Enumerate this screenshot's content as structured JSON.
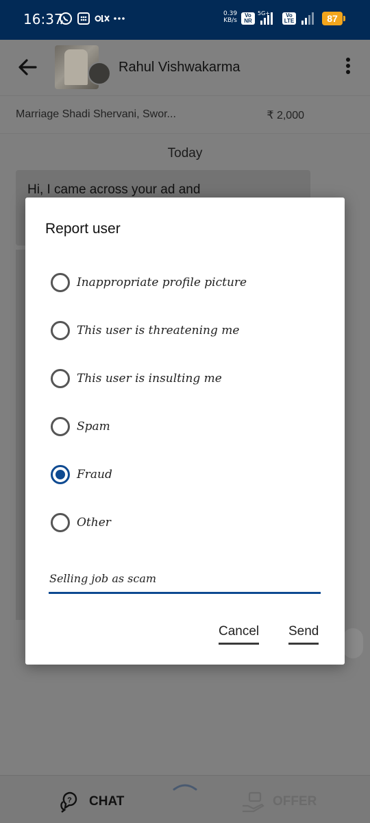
{
  "status_bar": {
    "time": "16:37",
    "speed_value": "0.39",
    "speed_unit": "KB/s",
    "badge1_top": "Vo",
    "badge1_bottom": "NR",
    "net_type": "5G+",
    "badge2_top": "Vo",
    "badge2_bottom": "LTE",
    "battery": "87",
    "icons": [
      "whatsapp-icon",
      "calendar-icon",
      "olx-icon",
      "more-dots-icon"
    ]
  },
  "header": {
    "contact_name": "Rahul Vishwakarma"
  },
  "ad": {
    "title": "Marriage Shadi Shervani, Swor...",
    "price": "₹ 2,000"
  },
  "chat": {
    "date_label": "Today",
    "first_message": "Hi, I came across your ad and"
  },
  "dialog": {
    "title": "Report user",
    "options": [
      {
        "label": "Inappropriate profile picture",
        "selected": false
      },
      {
        "label": "This user is threatening me",
        "selected": false
      },
      {
        "label": "This user is insulting me",
        "selected": false
      },
      {
        "label": "Spam",
        "selected": false
      },
      {
        "label": "Fraud",
        "selected": true
      },
      {
        "label": "Other",
        "selected": false
      }
    ],
    "comment_value": "Selling job as scam",
    "cancel_label": "Cancel",
    "send_label": "Send"
  },
  "bottom_bar": {
    "chat_label": "CHAT",
    "offer_label": "OFFER"
  },
  "colors": {
    "status_bar": "#022a56",
    "accent": "#0e4a91",
    "battery": "#f3a51c"
  }
}
